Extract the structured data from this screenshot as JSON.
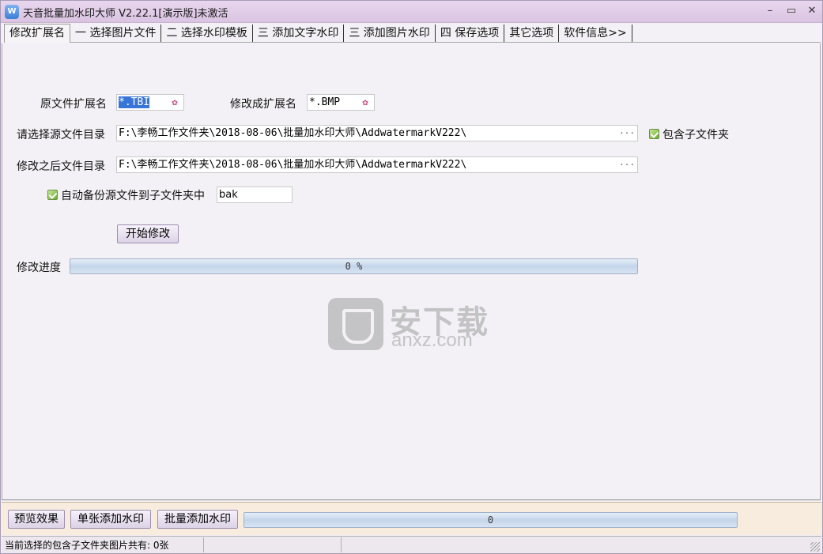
{
  "window": {
    "title": "天音批量加水印大师 V2.22.1[演示版]未激活",
    "icon_label": "W",
    "minimize": "–",
    "maximize": "▭",
    "close": "✕"
  },
  "tabs": [
    {
      "label": "修改扩展名",
      "active": true
    },
    {
      "label": "一  选择图片文件"
    },
    {
      "label": "二  选择水印模板"
    },
    {
      "label": "三  添加文字水印"
    },
    {
      "label": "三  添加图片水印"
    },
    {
      "label": "四  保存选项"
    },
    {
      "label": "其它选项"
    },
    {
      "label": "软件信息>>"
    }
  ],
  "form": {
    "orig_ext_label": "原文件扩展名",
    "orig_ext_value": "*.TBI",
    "new_ext_label": "修改成扩展名",
    "new_ext_value": "*.BMP",
    "source_dir_label": "请选择源文件目录",
    "source_dir_value": "F:\\李畅工作文件夹\\2018-08-06\\批量加水印大师\\AddwatermarkV222\\",
    "include_subfolders_label": "包含子文件夹",
    "include_subfolders_checked": true,
    "target_dir_label": "修改之后文件目录",
    "target_dir_value": "F:\\李畅工作文件夹\\2018-08-06\\批量加水印大师\\AddwatermarkV222\\",
    "backup_label": "自动备份源文件到子文件夹中",
    "backup_checked": true,
    "backup_folder": "bak",
    "start_button": "开始修改",
    "progress_label": "修改进度",
    "progress_text": "0 %",
    "progress_value": 0
  },
  "watermark": {
    "cn": "安下载",
    "en": "anxz.com"
  },
  "toolbar": {
    "preview": "预览效果",
    "single_add": "单张添加水印",
    "batch_add": "批量添加水印",
    "progress_text": "0",
    "progress_value": 0
  },
  "statusbar": {
    "message": "当前选择的包含子文件夹图片共有: 0张",
    "cell2": "",
    "cell3": ""
  },
  "colors": {
    "titlebar": "#e3cfea",
    "selection": "#3875d7",
    "checkbox": "#6eab2f",
    "bottom_toolbar": "#f7ecde"
  }
}
